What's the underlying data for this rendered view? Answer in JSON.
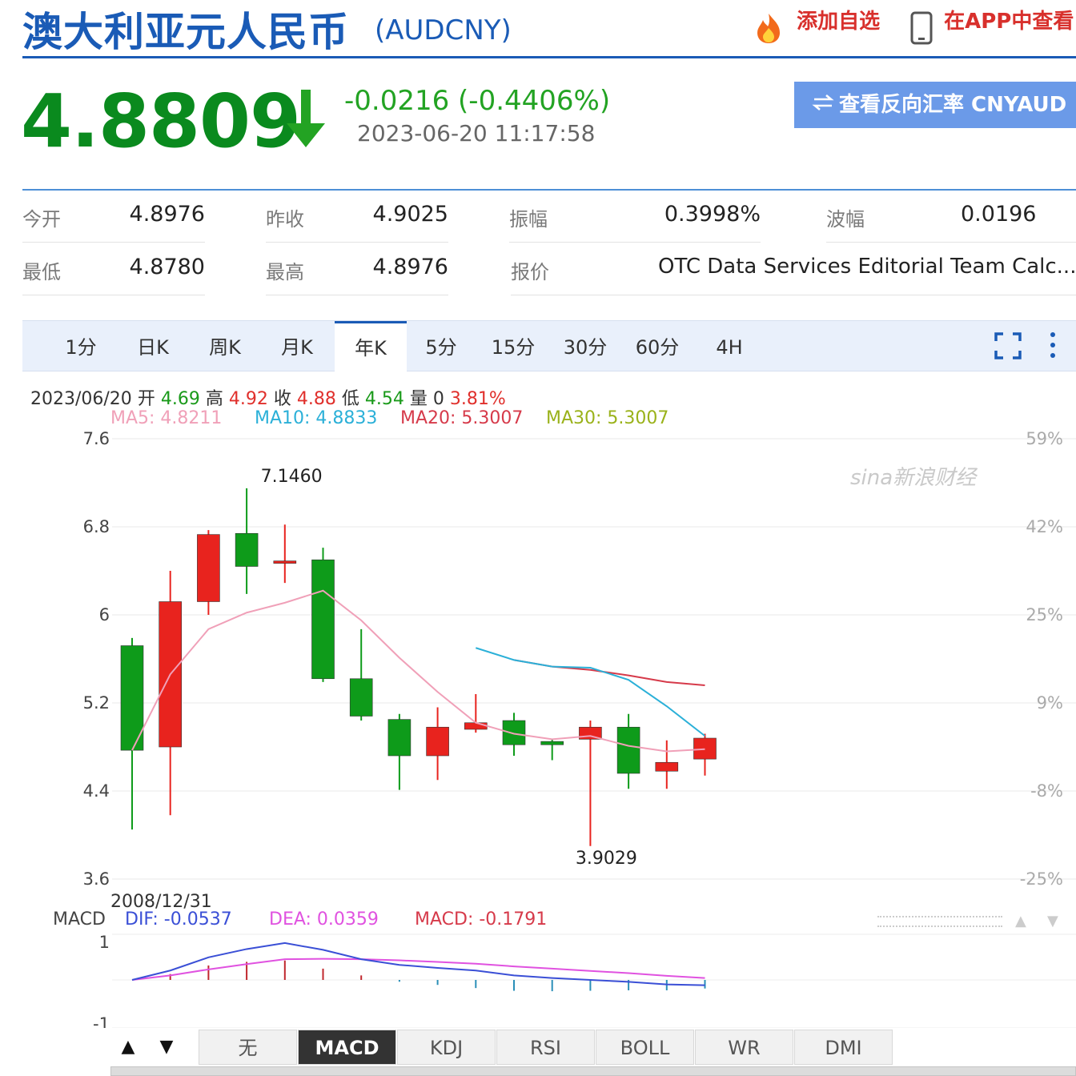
{
  "header": {
    "title": "澳大利亚元人民币",
    "code": "(AUDCNY)",
    "add_watch": "添加自选",
    "view_app": "在APP中查看",
    "fire_icon": "fire-icon",
    "phone_icon": "phone-icon"
  },
  "quote": {
    "price": "4.8809",
    "direction": "down",
    "change": "-0.0216 (-0.4406%)",
    "timestamp": "2023-06-20 11:17:58",
    "reverse_label": "查看反向汇率 CNYAUD",
    "down_color": "#0a8a1e"
  },
  "stats": [
    {
      "label": "今开",
      "value": "4.8976"
    },
    {
      "label": "昨收",
      "value": "4.9025"
    },
    {
      "label": "振幅",
      "value": "0.3998%"
    },
    {
      "label": "波幅",
      "value": "0.0196"
    },
    {
      "label": "最低",
      "value": "4.8780"
    },
    {
      "label": "最高",
      "value": "4.8976"
    },
    {
      "label": "报价",
      "value": "OTC Data Services Editorial Team Calc..."
    }
  ],
  "tabs": [
    "1分",
    "日K",
    "周K",
    "月K",
    "年K",
    "5分",
    "15分",
    "30分",
    "60分",
    "4H"
  ],
  "active_tab": "年K",
  "info_line": {
    "date": "2023/06/20",
    "open_label": "开",
    "open": "4.69",
    "high_label": "高",
    "high": "4.92",
    "close_label": "收",
    "close": "4.88",
    "low_label": "低",
    "low": "4.54",
    "vol_label": "量",
    "vol": "0",
    "pct": "3.81%"
  },
  "ma_line": {
    "ma5": "MA5: 4.8211",
    "ma10": "MA10: 4.8833",
    "ma20": "MA20: 5.3007",
    "ma30": "MA30: 5.3007"
  },
  "watermark": "sina新浪财经",
  "chart_data": {
    "type": "candlestick",
    "y_ticks": [
      "7.6",
      "6.8",
      "6",
      "5.2",
      "4.4",
      "3.6"
    ],
    "ylim": [
      3.6,
      7.6
    ],
    "pct_ticks": [
      "59%",
      "42%",
      "25%",
      "9%",
      "-8%",
      "-25%"
    ],
    "max_label": "7.1460",
    "min_label": "3.9029",
    "candles": [
      {
        "o": 5.72,
        "c": 4.77,
        "h": 5.79,
        "l": 4.05
      },
      {
        "o": 4.8,
        "c": 6.12,
        "h": 6.4,
        "l": 4.18
      },
      {
        "o": 6.12,
        "c": 6.73,
        "h": 6.77,
        "l": 6.0
      },
      {
        "o": 6.74,
        "c": 6.44,
        "h": 7.15,
        "l": 6.19
      },
      {
        "o": 6.49,
        "c": 6.49,
        "h": 6.82,
        "l": 6.29
      },
      {
        "o": 6.5,
        "c": 5.42,
        "h": 6.61,
        "l": 5.39
      },
      {
        "o": 5.42,
        "c": 5.08,
        "h": 5.87,
        "l": 5.04
      },
      {
        "o": 5.05,
        "c": 4.72,
        "h": 5.1,
        "l": 4.41
      },
      {
        "o": 4.72,
        "c": 4.98,
        "h": 5.16,
        "l": 4.5
      },
      {
        "o": 4.96,
        "c": 5.02,
        "h": 5.28,
        "l": 4.93
      },
      {
        "o": 5.04,
        "c": 4.82,
        "h": 5.11,
        "l": 4.72
      },
      {
        "o": 4.85,
        "c": 4.82,
        "h": 4.87,
        "l": 4.68
      },
      {
        "o": 4.87,
        "c": 4.98,
        "h": 5.04,
        "l": 3.9
      },
      {
        "o": 4.98,
        "c": 4.56,
        "h": 5.1,
        "l": 4.42
      },
      {
        "o": 4.58,
        "c": 4.66,
        "h": 4.86,
        "l": 4.42
      },
      {
        "o": 4.69,
        "c": 4.88,
        "h": 4.92,
        "l": 4.54
      }
    ],
    "ma5": [
      4.77,
      5.46,
      5.87,
      6.02,
      6.11,
      6.22,
      5.95,
      5.61,
      5.3,
      5.02,
      4.92,
      4.87,
      4.9,
      4.81,
      4.76,
      4.78
    ],
    "ma10": [
      null,
      null,
      null,
      null,
      null,
      null,
      null,
      null,
      null,
      5.7,
      5.59,
      5.53,
      5.52,
      5.41,
      5.17,
      4.9
    ],
    "ma20": [
      null,
      null,
      null,
      null,
      null,
      null,
      null,
      null,
      null,
      null,
      5.59,
      5.53,
      5.5,
      5.45,
      5.39,
      5.36
    ],
    "macd_header": {
      "date": "2008/12/31",
      "label": "MACD",
      "dif": "DIF: -0.0537",
      "dea": "DEA: 0.0359",
      "macd": "MACD: -0.1791"
    },
    "macd_ticks": [
      "1",
      "-1"
    ],
    "dif": [
      0.0,
      0.25,
      0.6,
      0.82,
      0.98,
      0.8,
      0.55,
      0.4,
      0.32,
      0.25,
      0.12,
      0.05,
      0.0,
      -0.05,
      -0.12,
      -0.14
    ],
    "dea": [
      0.0,
      0.12,
      0.28,
      0.42,
      0.55,
      0.56,
      0.55,
      0.52,
      0.48,
      0.43,
      0.36,
      0.3,
      0.24,
      0.18,
      0.11,
      0.05
    ],
    "macd_bars": [
      0.0,
      0.26,
      0.64,
      0.8,
      0.86,
      0.5,
      0.2,
      -0.08,
      -0.22,
      -0.36,
      -0.48,
      -0.5,
      -0.48,
      -0.46,
      -0.46,
      -0.38
    ]
  },
  "bottom_tabs": [
    "无",
    "MACD",
    "KDJ",
    "RSI",
    "BOLL",
    "WR",
    "DMI"
  ],
  "bottom_active": "MACD",
  "colors": {
    "up": "#e8231e",
    "down": "#0e9b1a",
    "ma5": "#f0a0b8",
    "ma10": "#2bb0d8",
    "ma20": "#d63a4a",
    "ma30": "#9ab21a",
    "dif": "#3a4fd6",
    "dea": "#e052e0",
    "accent": "#1a5bb6"
  }
}
